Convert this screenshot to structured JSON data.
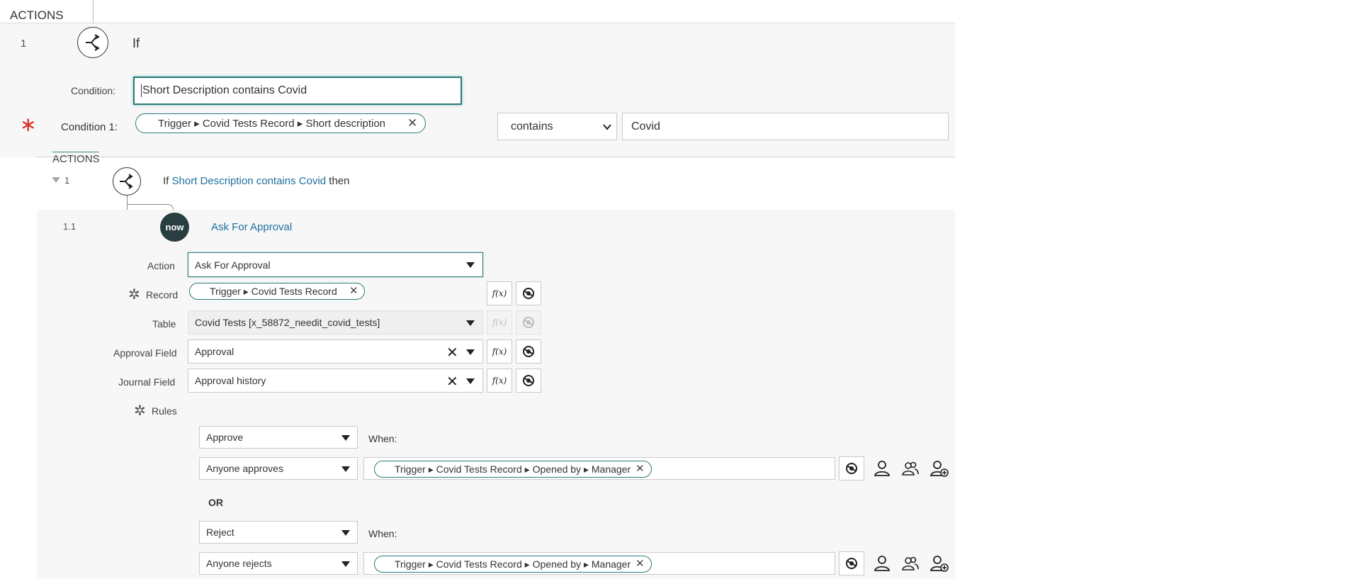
{
  "top_panel": {
    "header": "ACTIONS",
    "step_number": "1",
    "step_label": "If",
    "condition_label": "Condition:",
    "condition_value": "Short Description contains Covid",
    "condition1_label": "Condition 1:",
    "condition1_pill": "Trigger ▸ Covid Tests Record ▸ Short description",
    "operator": "contains",
    "value": "Covid"
  },
  "bottom_panel": {
    "header": "ACTIONS",
    "step_number": "1",
    "if_prefix": "If",
    "if_link": "Short Description contains Covid",
    "if_suffix": "then",
    "substep_number": "1.1",
    "now_logo": "now",
    "substep_title": "Ask For Approval",
    "fields": {
      "action_label": "Action",
      "action_value": "Ask For Approval",
      "record_label": "Record",
      "record_pill": "Trigger ▸ Covid Tests Record",
      "table_label": "Table",
      "table_value": "Covid Tests [x_58872_needit_covid_tests]",
      "approval_field_label": "Approval Field",
      "approval_field_value": "Approval",
      "journal_field_label": "Journal Field",
      "journal_field_value": "Approval history",
      "rules_label": "Rules"
    },
    "fx_label": "f(x)",
    "rules": {
      "approve_select": "Approve",
      "when1": "When:",
      "approve_condition": "Anyone approves",
      "approve_pill": "Trigger ▸ Covid Tests Record ▸ Opened by ▸ Manager",
      "or_label": "OR",
      "reject_select": "Reject",
      "when2": "When:",
      "reject_condition": "Anyone rejects",
      "reject_pill": "Trigger ▸ Covid Tests Record ▸ Opened by ▸ Manager"
    }
  },
  "colors": {
    "accent": "#2b7a78",
    "link": "#1f6f9f",
    "required": "#d9302c",
    "panel_bg": "#f7f7f7"
  }
}
